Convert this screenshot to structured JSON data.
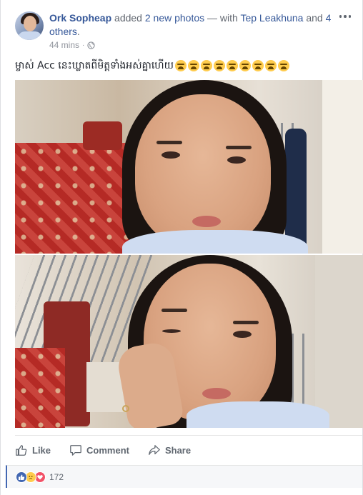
{
  "post": {
    "author": "Ork Sopheap",
    "action_text_1": " added ",
    "photos_link": "2 new photos",
    "with_text": " — with ",
    "tagged": "Tep Leakhuna",
    "and_text": " and ",
    "others_link": "4 others",
    "period": ".",
    "timestamp": "44 mins",
    "separator": "·",
    "privacy_icon": "globe-icon",
    "caption": "ម្ចាស់ Acc នេះឃ្លាតពីមិត្តទាំងអស់គ្នាហើយ",
    "caption_emoji_count": 9,
    "caption_emoji": "crying-face-emoji"
  },
  "photos": [
    {
      "label": "photo-1",
      "description_icon": "selfie-photo"
    },
    {
      "label": "photo-2",
      "description_icon": "selfie-wink-photo"
    }
  ],
  "actions": {
    "like_label": "Like",
    "comment_label": "Comment",
    "share_label": "Share"
  },
  "reactions": {
    "count": "172",
    "types": [
      "like",
      "sad",
      "love"
    ]
  },
  "colors": {
    "link": "#365899",
    "meta": "#90949c",
    "action_text": "#606770",
    "like_blue": "#4267b2",
    "love_red": "#f25268",
    "sad_yellow": "#ffcc4d"
  }
}
